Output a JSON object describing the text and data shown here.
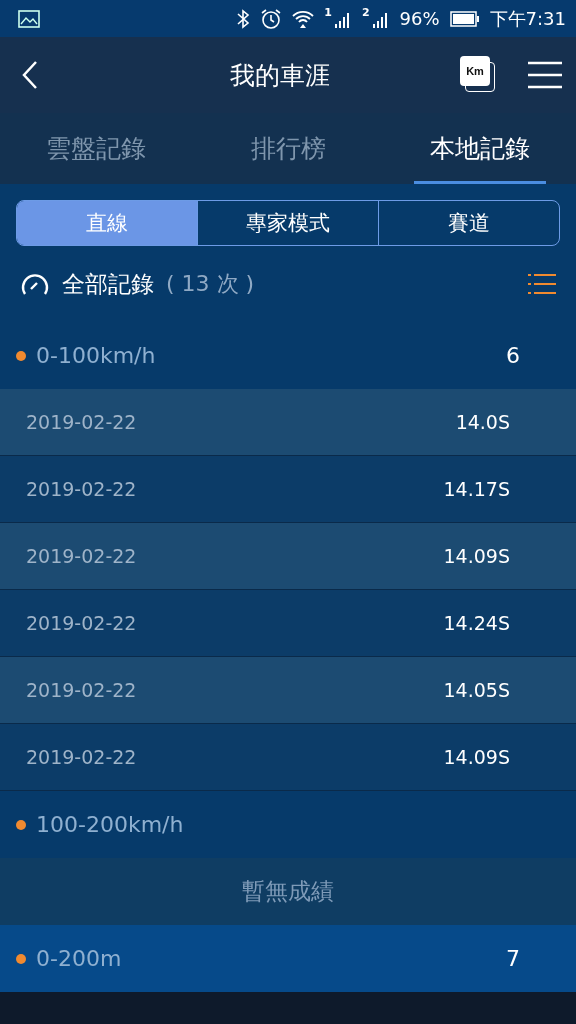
{
  "status_bar": {
    "sim_1": "1",
    "sim_2": "2",
    "battery": "96%",
    "time": "下午7:31"
  },
  "header": {
    "title": "我的車涯",
    "unit_badge": "Km"
  },
  "tabs": [
    {
      "label": "雲盤記錄",
      "selected": false
    },
    {
      "label": "排行榜",
      "selected": false
    },
    {
      "label": "本地記錄",
      "selected": true
    }
  ],
  "segments": [
    {
      "label": "直線",
      "selected": true
    },
    {
      "label": "專家模式",
      "selected": false
    },
    {
      "label": "賽道",
      "selected": false
    }
  ],
  "summary": {
    "title": "全部記錄",
    "count": "( 13 次 )"
  },
  "groups": [
    {
      "label": "0-100km/h",
      "count": "6",
      "records": [
        {
          "date": "2019-02-22",
          "time": "14.0S"
        },
        {
          "date": "2019-02-22",
          "time": "14.17S"
        },
        {
          "date": "2019-02-22",
          "time": "14.09S"
        },
        {
          "date": "2019-02-22",
          "time": "14.24S"
        },
        {
          "date": "2019-02-22",
          "time": "14.05S"
        },
        {
          "date": "2019-02-22",
          "time": "14.09S"
        }
      ]
    },
    {
      "label": "100-200km/h",
      "empty": "暫無成績"
    },
    {
      "label": "0-200m",
      "count": "7"
    }
  ]
}
